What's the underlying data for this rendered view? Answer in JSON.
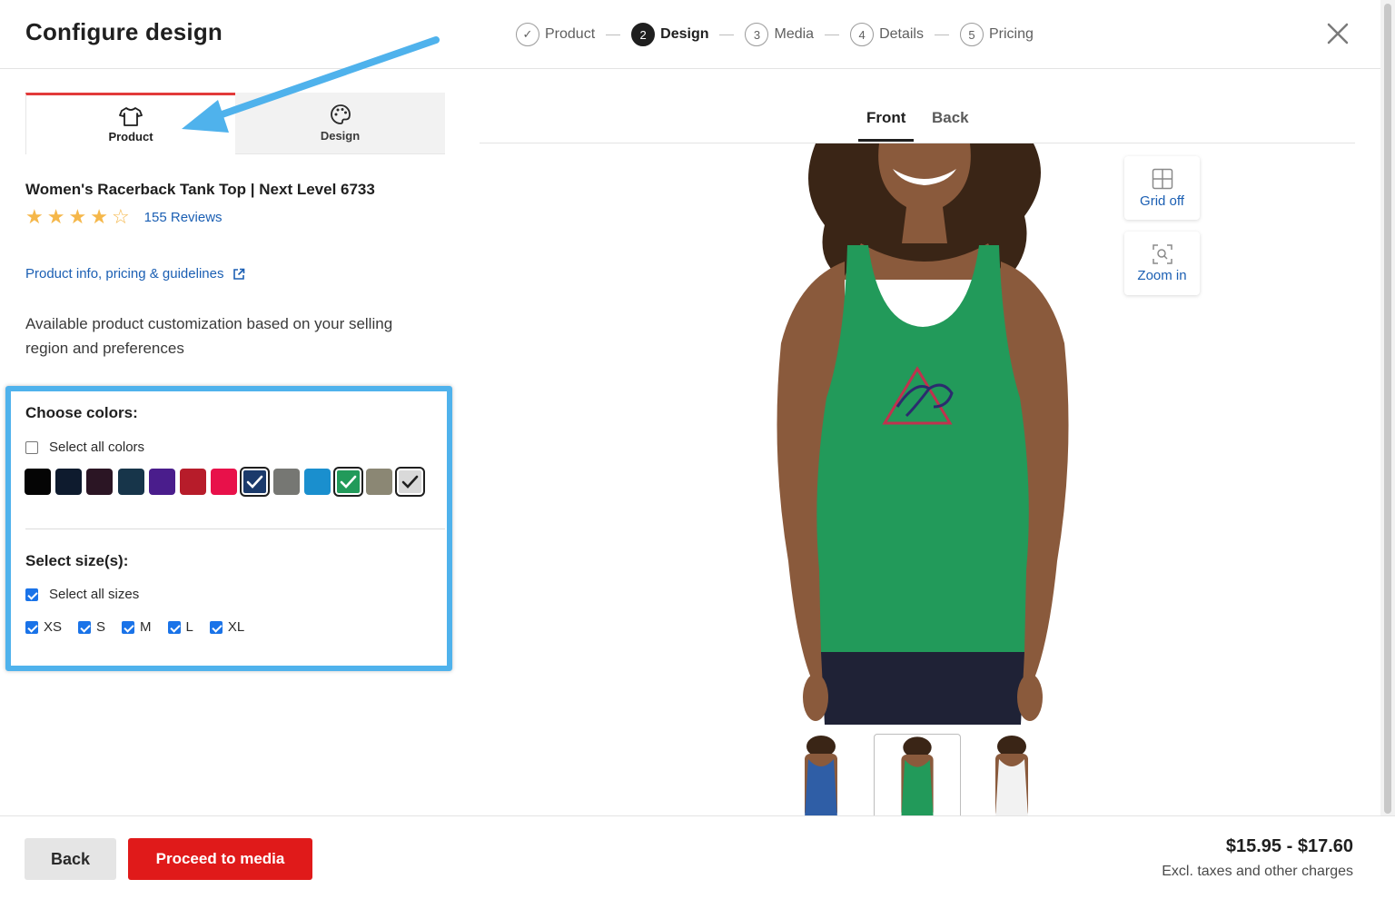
{
  "header": {
    "title": "Configure design",
    "steps": [
      {
        "num": "✓",
        "label": "Product"
      },
      {
        "num": "2",
        "label": "Design"
      },
      {
        "num": "3",
        "label": "Media"
      },
      {
        "num": "4",
        "label": "Details"
      },
      {
        "num": "5",
        "label": "Pricing"
      }
    ],
    "close_icon": "close-icon"
  },
  "left_tabs": {
    "product_label": "Product",
    "design_label": "Design",
    "product_icon": "tshirt-icon",
    "design_icon": "palette-icon"
  },
  "product": {
    "name": "Women's Racerback Tank Top | Next Level 6733",
    "rating": 4,
    "rating_max": 5,
    "reviews": "155 Reviews",
    "info_link": "Product info, pricing & guidelines",
    "description": "Available product customization based on your selling region and preferences"
  },
  "colors": {
    "title": "Choose colors:",
    "select_all": "Select all colors",
    "swatches": [
      {
        "hex": "#050505",
        "selected": false
      },
      {
        "hex": "#0e1b2e",
        "selected": false
      },
      {
        "hex": "#2b1524",
        "selected": false
      },
      {
        "hex": "#17354a",
        "selected": false
      },
      {
        "hex": "#4a1d8c",
        "selected": false
      },
      {
        "hex": "#b71c2a",
        "selected": false
      },
      {
        "hex": "#e8114a",
        "selected": false
      },
      {
        "hex": "#1b3a6b",
        "selected": true
      },
      {
        "hex": "#767773",
        "selected": false
      },
      {
        "hex": "#1a8fce",
        "selected": false
      },
      {
        "hex": "#229a5a",
        "selected": true
      },
      {
        "hex": "#8b8774",
        "selected": false
      },
      {
        "hex": "#d9d9d9",
        "selected": true
      }
    ]
  },
  "sizes": {
    "title": "Select size(s):",
    "select_all": "Select all sizes",
    "items": [
      "XS",
      "S",
      "M",
      "L",
      "XL"
    ]
  },
  "preview": {
    "front_tab": "Front",
    "back_tab": "Back",
    "grid_label": "Grid off",
    "zoom_label": "Zoom in",
    "shirt_color": "#229a5a",
    "thumb_colors": [
      "#2f5ea6",
      "#229a5a",
      "#f2f2f2"
    ]
  },
  "footer": {
    "back_label": "Back",
    "proceed_label": "Proceed to media",
    "price": "$15.95 - $17.60",
    "price_note": "Excl. taxes and other charges"
  }
}
